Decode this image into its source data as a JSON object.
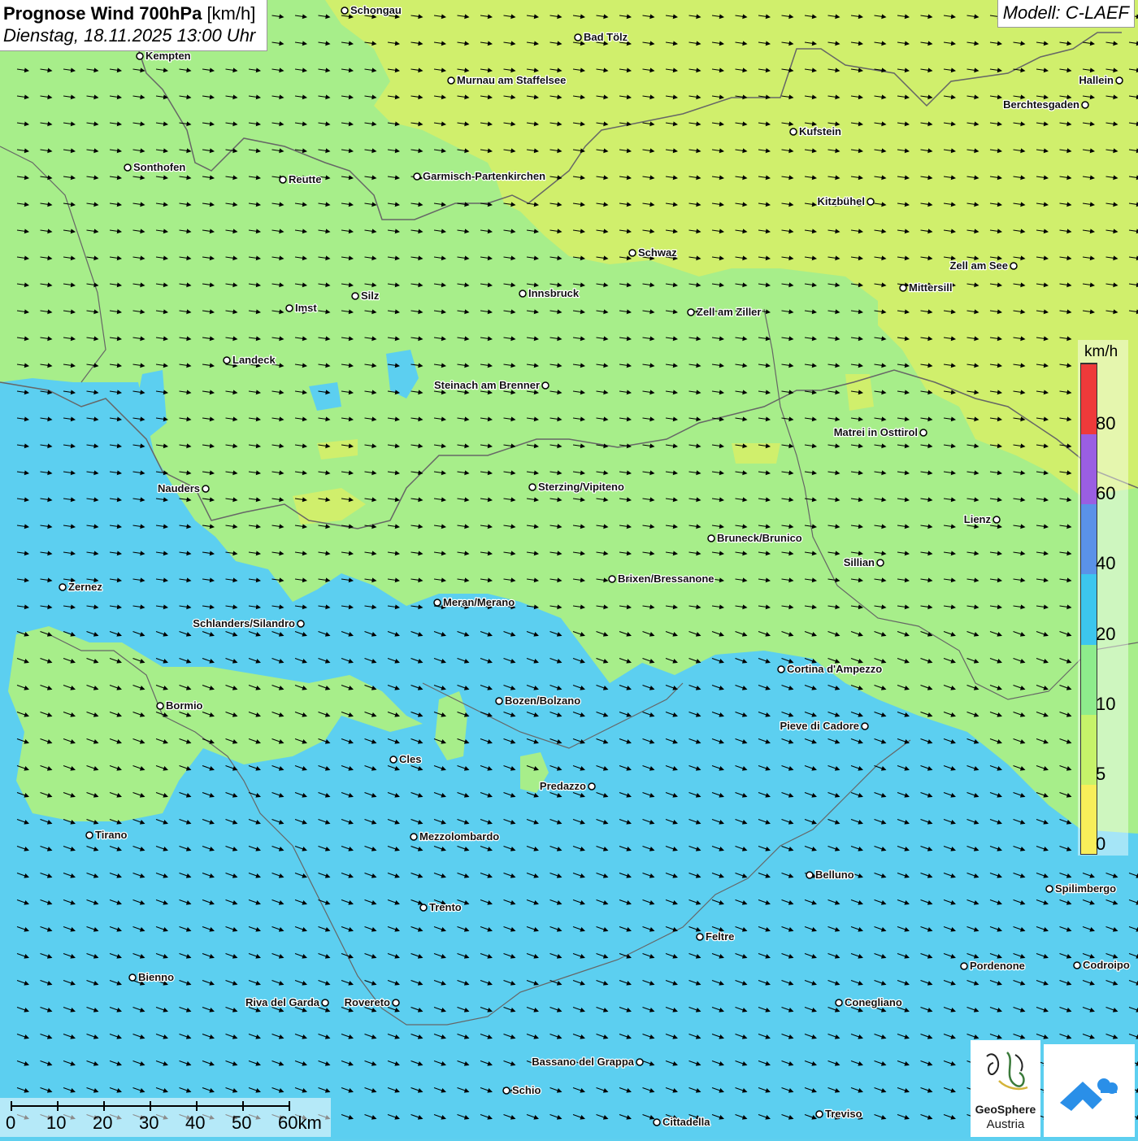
{
  "header": {
    "title_bold": "Prognose Wind 700hPa",
    "title_unit": "[km/h]",
    "date": "Dienstag, 18.11.2025 13:00 Uhr"
  },
  "model": "Modell: C-LAEF",
  "legend": {
    "unit": "km/h",
    "ticks": [
      "0",
      "5",
      "10",
      "20",
      "40",
      "60",
      "80"
    ],
    "colors": [
      "#f8ee5a",
      "#c6f36a",
      "#8eec8c",
      "#3cc6ee",
      "#5a92e8",
      "#9a5ee2",
      "#ee3a3a"
    ]
  },
  "colors": {
    "wind_0_5": "#cdee62",
    "wind_5_10": "#a6ee86",
    "wind_10_20": "#59ccef",
    "wind_yellow": "#d7f070"
  },
  "scalebar": {
    "labels": [
      "0",
      "10",
      "20",
      "30",
      "40",
      "50",
      "60km"
    ]
  },
  "logos": {
    "geosphere_line1": "GeoSphere",
    "geosphere_line2": "Austria",
    "geosphere_icon": "geosphere-icon",
    "app_icon": "weather-app-icon"
  },
  "wind_arrows": {
    "grid_spacing_km": "arrow grid",
    "direction": "east-southeast"
  },
  "cities": [
    {
      "name": "Schongau"
    },
    {
      "name": "Bad Tölz"
    },
    {
      "name": "Kempten"
    },
    {
      "name": "Murnau am Staffelsee"
    },
    {
      "name": "Hallein"
    },
    {
      "name": "Berchtesgaden"
    },
    {
      "name": "Kufstein"
    },
    {
      "name": "Sonthofen"
    },
    {
      "name": "Reutte"
    },
    {
      "name": "Garmisch-Partenkirchen"
    },
    {
      "name": "Kitzbühel"
    },
    {
      "name": "Schwaz"
    },
    {
      "name": "Zell am See"
    },
    {
      "name": "Mittersill"
    },
    {
      "name": "Innsbruck"
    },
    {
      "name": "Silz"
    },
    {
      "name": "Imst"
    },
    {
      "name": "Zell am Ziller"
    },
    {
      "name": "Landeck"
    },
    {
      "name": "Steinach am Brenner"
    },
    {
      "name": "Matrei in Osttirol"
    },
    {
      "name": "Nauders"
    },
    {
      "name": "Sterzing/Vipiteno"
    },
    {
      "name": "Lienz"
    },
    {
      "name": "Bruneck/Brunico"
    },
    {
      "name": "Sillian"
    },
    {
      "name": "Zernez"
    },
    {
      "name": "Brixen/Bressanone"
    },
    {
      "name": "Meran/Merano"
    },
    {
      "name": "Schlanders/Silandro"
    },
    {
      "name": "Cortina d'Ampezzo"
    },
    {
      "name": "Bozen/Bolzano"
    },
    {
      "name": "Bormio"
    },
    {
      "name": "Pieve di Cadore"
    },
    {
      "name": "Cles"
    },
    {
      "name": "Predazzo"
    },
    {
      "name": "Tirano"
    },
    {
      "name": "Mezzolombardo"
    },
    {
      "name": "Belluno"
    },
    {
      "name": "Spilimbergo"
    },
    {
      "name": "Trento"
    },
    {
      "name": "Feltre"
    },
    {
      "name": "Pordenone"
    },
    {
      "name": "Codroipo"
    },
    {
      "name": "Bienno"
    },
    {
      "name": "Riva del Garda"
    },
    {
      "name": "Rovereto"
    },
    {
      "name": "Conegliano"
    },
    {
      "name": "Bassano del Grappa"
    },
    {
      "name": "Schio"
    },
    {
      "name": "Treviso"
    },
    {
      "name": "Cittadella"
    }
  ]
}
